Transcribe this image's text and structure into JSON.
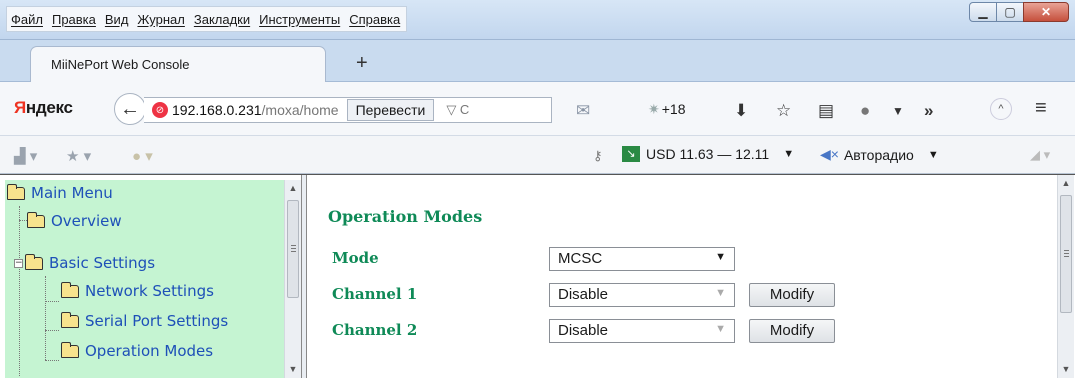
{
  "menu": [
    "Файл",
    "Правка",
    "Вид",
    "Журнал",
    "Закладки",
    "Инструменты",
    "Справка"
  ],
  "tab": {
    "title": "MiiNePort Web Console",
    "new_tab": "+"
  },
  "nav": {
    "brand_first": "Я",
    "brand_rest": "ндекс",
    "url_host": "192.168.0.231",
    "url_path": "/moxa/home",
    "translate_label": "Перевести",
    "weather": "+18"
  },
  "bookmarks": {
    "currency": "USD 11.63 — 12.11",
    "radio": "Авторадио"
  },
  "sidebar": {
    "items": [
      {
        "label": "Main Menu"
      },
      {
        "label": "Overview"
      },
      {
        "label": "Basic Settings"
      },
      {
        "label": "Network Settings"
      },
      {
        "label": "Serial Port Settings"
      },
      {
        "label": "Operation Modes"
      }
    ]
  },
  "main": {
    "title": "Operation Modes",
    "fields": [
      {
        "label": "Mode",
        "value": "MCSC"
      },
      {
        "label": "Channel 1",
        "value": "Disable",
        "button": "Modify"
      },
      {
        "label": "Channel 2",
        "value": "Disable",
        "button": "Modify"
      }
    ]
  },
  "colors": {
    "sidebar_bg": "#c5f4d2",
    "tree_link": "#1e50b8",
    "heading_green": "#0f8a57"
  },
  "icons": [
    "back-arrow-icon",
    "site-icon",
    "reload-icon",
    "mail-icon",
    "sun-icon",
    "download-icon",
    "star-icon",
    "reading-list-icon",
    "chat-icon",
    "overflow-icon",
    "scroll-up-icon",
    "hamburger-icon",
    "key-icon",
    "chart-icon",
    "speaker-muted-icon",
    "signal-icon",
    "folder-icon"
  ]
}
